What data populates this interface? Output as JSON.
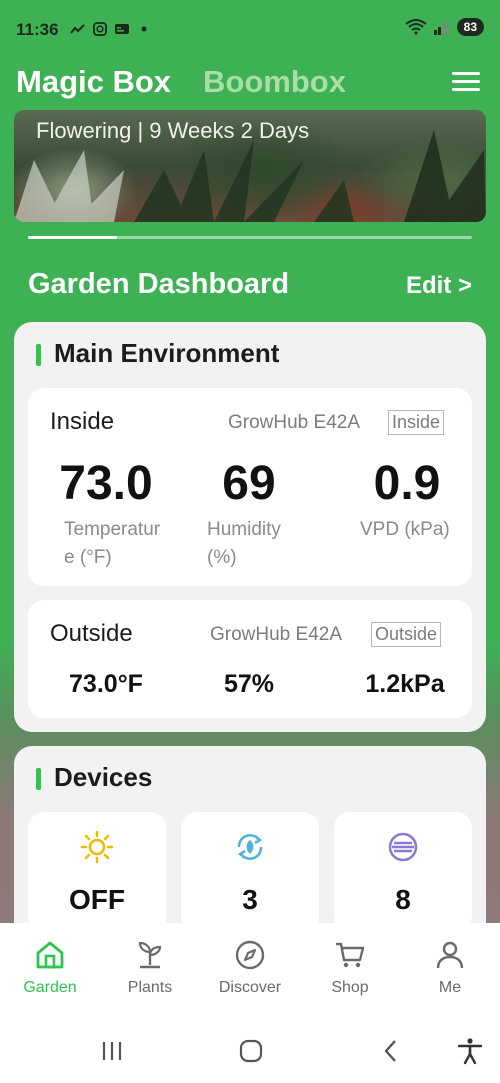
{
  "status_bar": {
    "time": "11:36",
    "battery": "83"
  },
  "header": {
    "title": "Magic Box",
    "subtitle": "Boombox"
  },
  "banner": {
    "stage_text": "Flowering | 9 Weeks 2 Days",
    "progress": 0.2
  },
  "dashboard": {
    "title": "Garden Dashboard",
    "edit_label": "Edit >"
  },
  "main_environment": {
    "title": "Main Environment",
    "inside": {
      "label": "Inside",
      "hub": "GrowHub E42A",
      "tag": "Inside",
      "temperature": "73.0",
      "temperature_label_line1": "Temperatur",
      "temperature_label_line2": "e (°F)",
      "humidity": "69",
      "humidity_label_line1": "Humidity",
      "humidity_label_line2": "(%)",
      "vpd": "0.9",
      "vpd_label": "VPD (kPa)"
    },
    "outside": {
      "label": "Outside",
      "hub": "GrowHub E42A",
      "tag": "Outside",
      "temperature": "73.0°F",
      "humidity": "57%",
      "vpd": "1.2kPa"
    }
  },
  "devices": {
    "title": "Devices",
    "items": [
      {
        "icon": "sun-icon",
        "value": "OFF",
        "color": "#f2b705"
      },
      {
        "icon": "recycle-leaf-icon",
        "value": "3",
        "color": "#4fb3d9"
      },
      {
        "icon": "circulation-icon",
        "value": "8",
        "color": "#8a7ad6"
      }
    ]
  },
  "bottom_nav": {
    "items": [
      {
        "label": "Garden",
        "icon": "home-icon",
        "active": true
      },
      {
        "label": "Plants",
        "icon": "sprout-icon",
        "active": false
      },
      {
        "label": "Discover",
        "icon": "compass-icon",
        "active": false
      },
      {
        "label": "Shop",
        "icon": "cart-icon",
        "active": false
      },
      {
        "label": "Me",
        "icon": "person-icon",
        "active": false
      }
    ]
  },
  "colors": {
    "brand_green": "#3db153",
    "accent_green": "#2ec54c"
  }
}
